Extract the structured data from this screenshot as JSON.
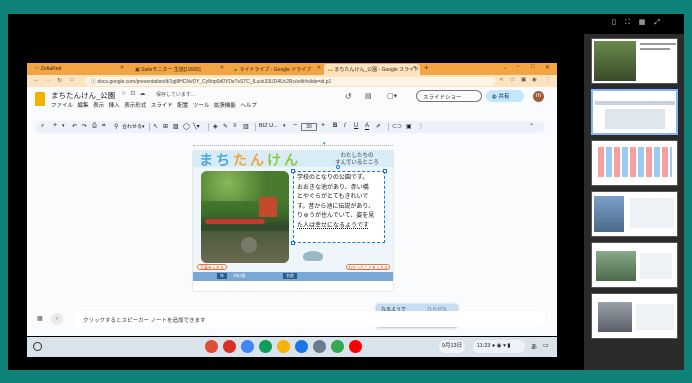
{
  "tabs": [
    {
      "label": "ZettaRed",
      "icon": "paw-icon"
    },
    {
      "label": "Suiteモニター 生徒[19905]",
      "icon": "monitor-icon"
    },
    {
      "label": "マイドライブ - Google ドライブ",
      "icon": "drive-icon"
    },
    {
      "label": "まちたんけん_公園 - Google スライド",
      "icon": "slides-icon"
    }
  ],
  "address": {
    "url": "docs.google.com/presentation/d/1pj8HCNvDY_Cy8op0d0YDe7sSTC_lLuck33UD4Uc2Rc/edit#slide=id.p1"
  },
  "doc": {
    "title": "まちたんけん_公園",
    "save_status": "保存しています...",
    "menus": [
      "ファイル",
      "編集",
      "表示",
      "挿入",
      "表示形式",
      "スライド",
      "配置",
      "ツール",
      "拡張機能",
      "ヘルプ"
    ],
    "slideshow_label": "スライドショー",
    "share_label": "共有",
    "avatar_letter": "m"
  },
  "toolbar": {
    "font": "BIZ U...",
    "font_size": "30"
  },
  "slide": {
    "title_chars": [
      "ま",
      "ち",
      "た",
      "ん",
      "け",
      "ん"
    ],
    "title_colors": [
      "#4ba9d6",
      "#4ba9d6",
      "#f2a23a",
      "#f2a23a",
      "#8cc93e",
      "#8cc93e"
    ],
    "subtitle_line1": "わたしたちの",
    "subtitle_line2": "すんでいるところ",
    "body_lines": [
      "学校のとなりの公園です。",
      "おおきな池があり、赤い橋",
      "とやぐらがとてもきれいで",
      "す。昔から池に伝説があり、",
      "りゅうが住んでいて、姿を見",
      "た人は幸せになるようです"
    ],
    "photo_btn": "写真を入れる",
    "found_btn": "わかったことを入れる",
    "footer_labels": [
      "年",
      "組",
      "名前"
    ],
    "footer_value": "3年2組"
  },
  "ime": {
    "candidate": "なるようで",
    "reading": "ひらがな",
    "hint": "Tabキーで選択"
  },
  "notes": {
    "placeholder": "クリックするとスピーカー ノートを追加できます"
  },
  "shelf": {
    "apps": [
      {
        "name": "chrome-icon",
        "color": "#e04b3a"
      },
      {
        "name": "gmail-icon",
        "color": "#d93025"
      },
      {
        "name": "docs-icon",
        "color": "#4285f4"
      },
      {
        "name": "sheets-icon",
        "color": "#0f9d58"
      },
      {
        "name": "classroom-icon",
        "color": "#f6b400"
      },
      {
        "name": "meet-icon",
        "color": "#1a73e8"
      },
      {
        "name": "camera-icon",
        "color": "#6b7b8c"
      },
      {
        "name": "play-icon",
        "color": "#34a853"
      },
      {
        "name": "youtube-icon",
        "color": "#ff0000"
      }
    ],
    "date": "9月13日",
    "time": "11:23",
    "ime": "あ"
  },
  "overview": {
    "thumbs": 6
  }
}
